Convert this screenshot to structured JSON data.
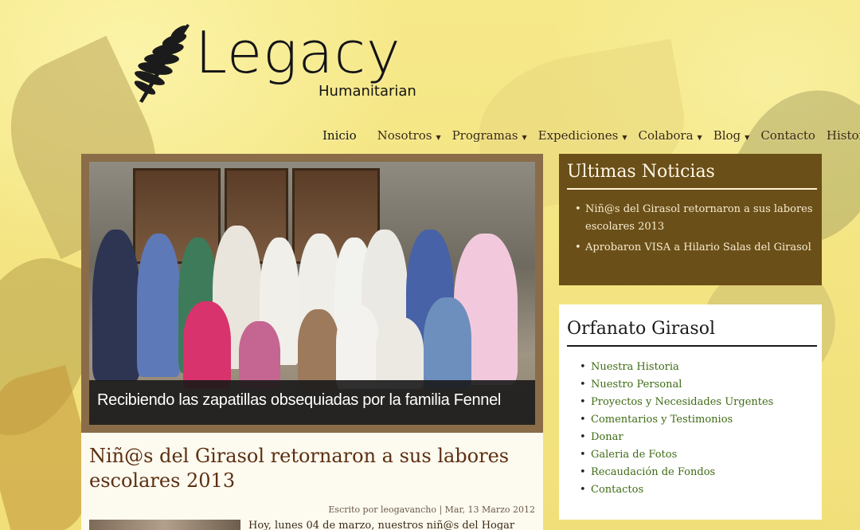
{
  "logo": {
    "word": "Legacy",
    "sub": "Humanitarian"
  },
  "nav": [
    {
      "label": "Inicio",
      "dropdown": false,
      "active": true
    },
    {
      "label": "Nosotros",
      "dropdown": true
    },
    {
      "label": "Programas",
      "dropdown": true
    },
    {
      "label": "Expediciones",
      "dropdown": true
    },
    {
      "label": "Colabora",
      "dropdown": true
    },
    {
      "label": "Blog",
      "dropdown": true
    },
    {
      "label": "Contacto",
      "dropdown": false
    },
    {
      "label": "Historia",
      "dropdown": false
    }
  ],
  "slider": {
    "caption": "Recibiendo las zapatillas obsequiadas por la familia Fennel"
  },
  "article": {
    "title": "Niñ@s del Girasol retornaron a sus labores escolares 2013",
    "meta": "Escrito por leogavancho | Mar, 13 Marzo 2012",
    "body": "Hoy, lunes 04 de marzo,  nuestros  niñ@s del Hogar"
  },
  "news": {
    "title": "Ultimas Noticias",
    "items": [
      "Niñ@s del Girasol retornaron a sus labores escolares 2013",
      "Aprobaron VISA a Hilario Salas del Girasol"
    ]
  },
  "orphanage": {
    "title": "Orfanato Girasol",
    "items": [
      "Nuestra Historia",
      "Nuestro Personal",
      "Proyectos y Necesidades Urgentes",
      "Comentarios y Testimonios",
      "Donar",
      "Galeria de Fotos",
      "Recaudación de Fondos",
      "Contactos"
    ]
  },
  "colors": {
    "news_bg": "#6b4f19",
    "link": "#3f6b14",
    "title": "#5c2f11",
    "slider_frame": "#8a6c49"
  }
}
